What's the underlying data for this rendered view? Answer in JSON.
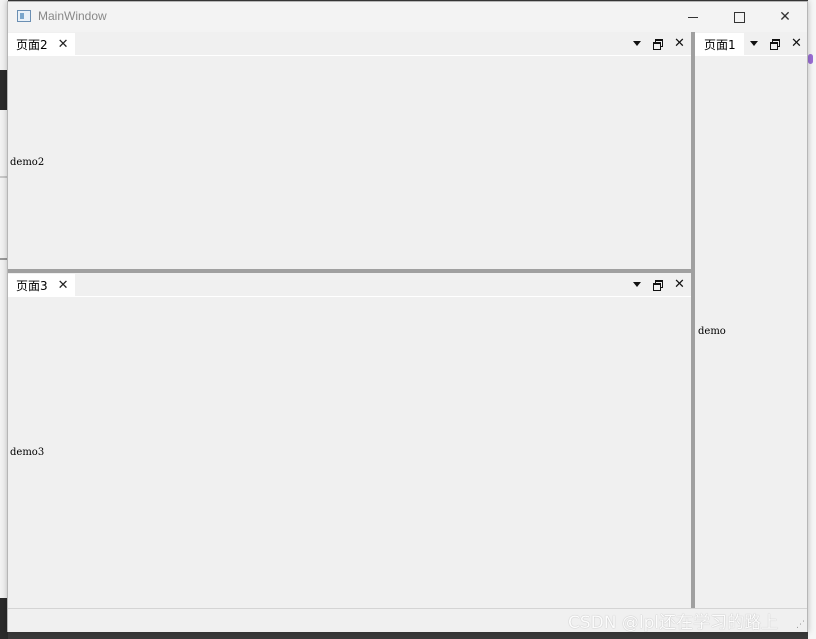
{
  "window": {
    "title": "MainWindow"
  },
  "panels": [
    {
      "tab_label": "页面2",
      "content": "demo2"
    },
    {
      "tab_label": "页面3",
      "content": "demo3"
    },
    {
      "tab_label": "页面1",
      "content": "demo"
    }
  ],
  "watermark": "CSDN @lpl还在学习的路上",
  "icons": {
    "close": "×",
    "caret": "dropdown-caret",
    "float": "float-window"
  }
}
